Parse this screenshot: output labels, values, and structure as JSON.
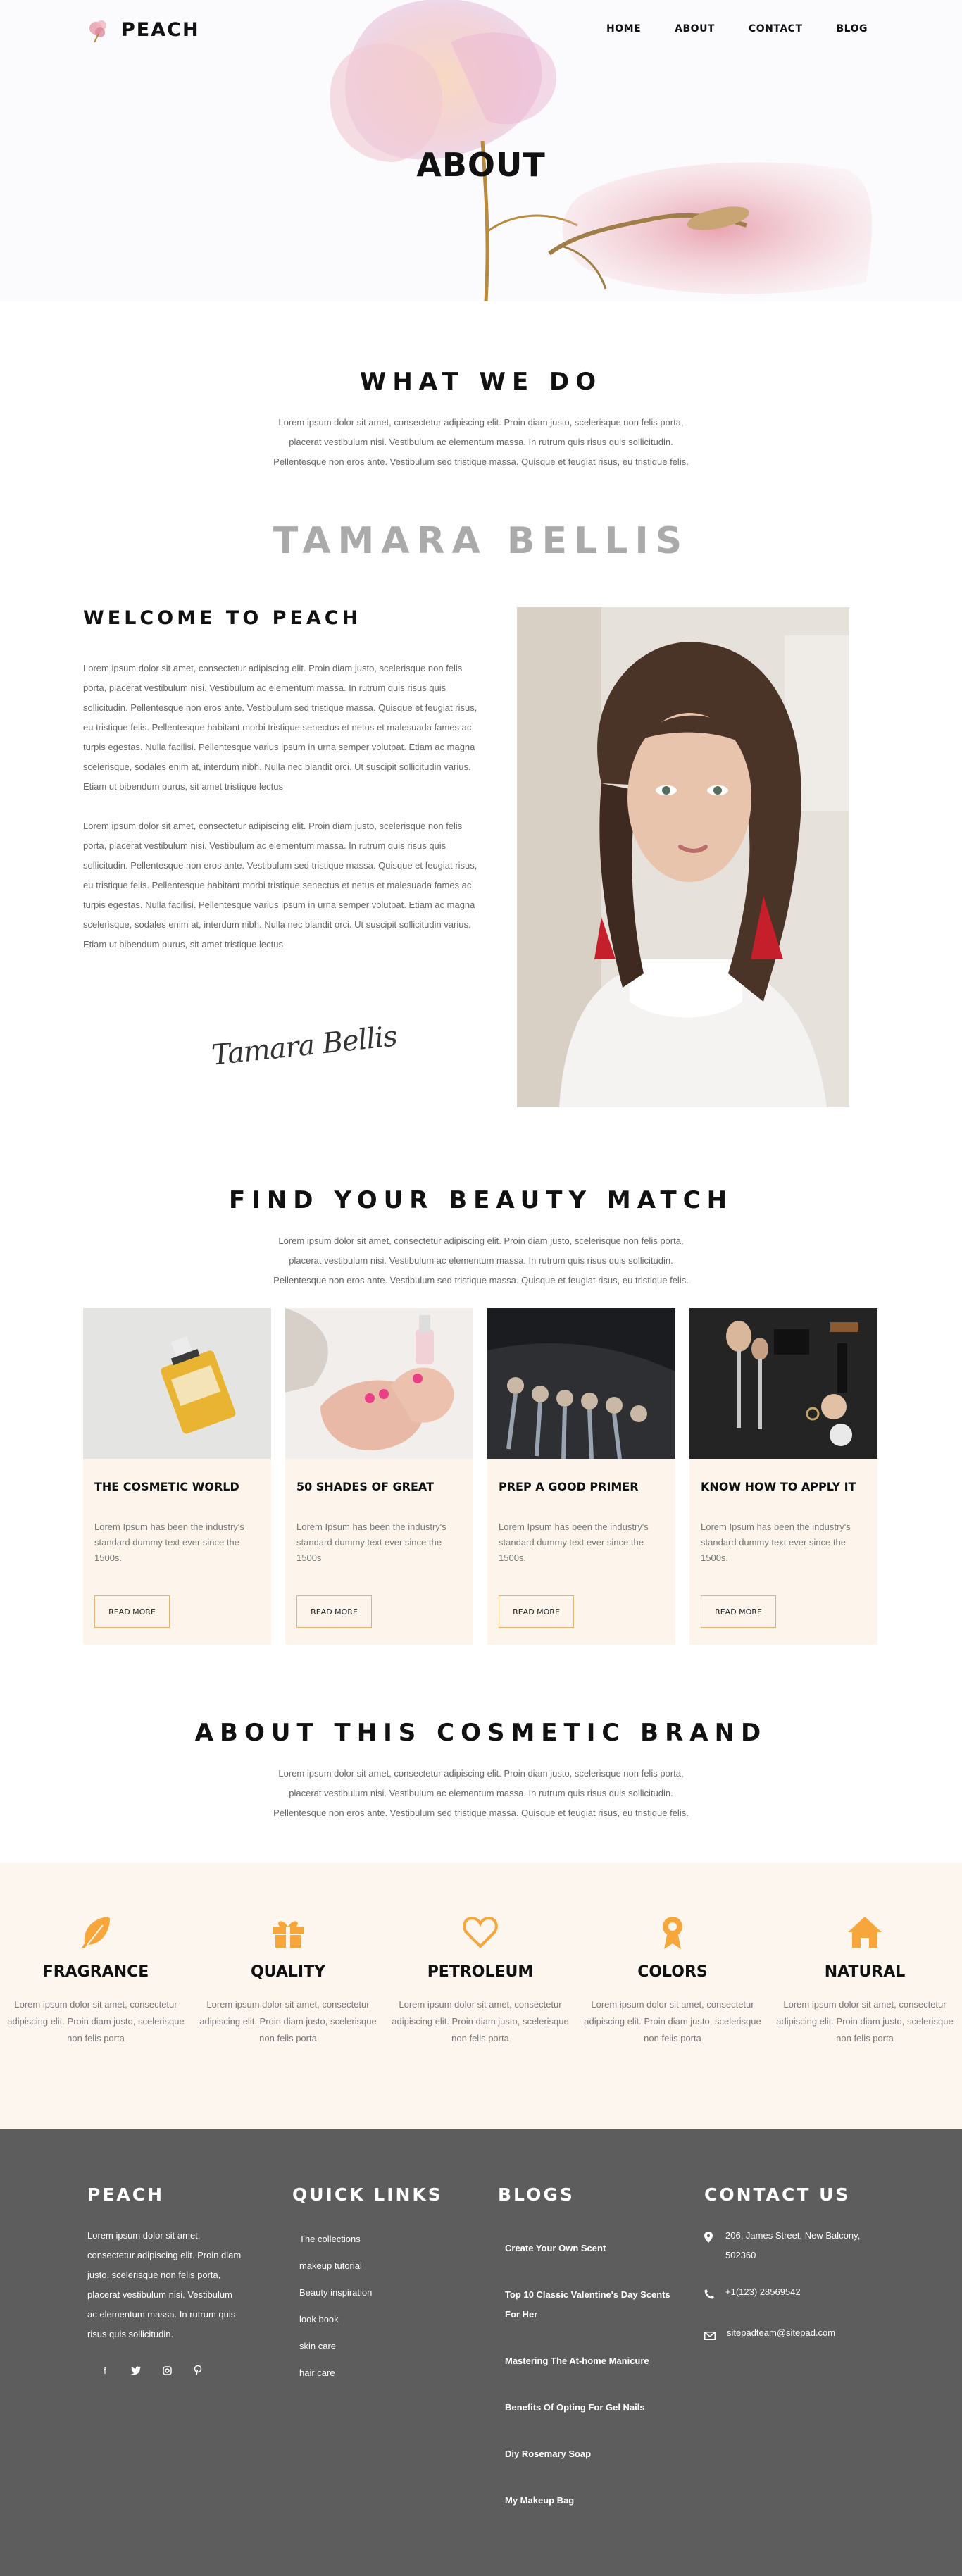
{
  "header": {
    "brand": "PEACH",
    "nav": [
      "HOME",
      "ABOUT",
      "CONTACT",
      "BLOG"
    ],
    "hero_title": "ABOUT"
  },
  "what_we_do": {
    "title": "WHAT WE DO",
    "lines": [
      "Lorem ipsum dolor sit amet, consectetur adipiscing elit. Proin diam justo, scelerisque non felis porta,",
      "placerat vestibulum nisi. Vestibulum ac elementum massa. In rutrum quis risus quis sollicitudin.",
      "Pellentesque non eros ante. Vestibulum sed tristique massa. Quisque et feugiat risus, eu tristique felis."
    ]
  },
  "founder": {
    "ghost_name": "TAMARA BELLIS",
    "heading": "WELCOME TO PEACH",
    "para1": "Lorem ipsum dolor sit amet, consectetur adipiscing elit. Proin diam justo, scelerisque non felis porta, placerat vestibulum nisi. Vestibulum ac elementum massa. In rutrum quis risus quis sollicitudin. Pellentesque non eros ante. Vestibulum sed tristique massa. Quisque et feugiat risus, eu tristique felis. Pellentesque habitant morbi tristique senectus et netus et malesuada fames ac turpis egestas. Nulla facilisi. Pellentesque varius ipsum in urna semper volutpat. Etiam ac magna scelerisque, sodales enim at, interdum nibh. Nulla nec blandit orci. Ut suscipit sollicitudin varius. Etiam ut bibendum purus, sit amet tristique lectus",
    "para2": "Lorem ipsum dolor sit amet, consectetur adipiscing elit. Proin diam justo, scelerisque non felis porta, placerat vestibulum nisi. Vestibulum ac elementum massa. In rutrum quis risus quis sollicitudin. Pellentesque non eros ante. Vestibulum sed tristique massa. Quisque et feugiat risus, eu tristique felis. Pellentesque habitant morbi tristique senectus et netus et malesuada fames ac turpis egestas. Nulla facilisi. Pellentesque varius ipsum in urna semper volutpat. Etiam ac magna scelerisque, sodales enim at, interdum nibh. Nulla nec blandit orci. Ut suscipit sollicitudin varius. Etiam ut bibendum purus, sit amet tristique lectus",
    "signature": "Tamara Bellis"
  },
  "beauty_match": {
    "title": "FIND YOUR BEAUTY MATCH",
    "lines": [
      "Lorem ipsum dolor sit amet, consectetur adipiscing elit. Proin diam justo, scelerisque non felis porta,",
      "placerat vestibulum nisi. Vestibulum ac elementum massa. In rutrum quis risus quis sollicitudin.",
      "Pellentesque non eros ante. Vestibulum sed tristique massa. Quisque et feugiat risus, eu tristique felis."
    ],
    "cards": [
      {
        "title": "THE COSMETIC WORLD",
        "text": "Lorem Ipsum has been the industry's standard dummy text ever since the 1500s.",
        "button": "READ MORE"
      },
      {
        "title": "50 SHADES OF GREAT",
        "text": "Lorem Ipsum has been the industry's standard dummy text ever since the 1500s",
        "button": "READ MORE"
      },
      {
        "title": "PREP A GOOD PRIMER",
        "text": "Lorem Ipsum has been the industry's standard dummy text ever since the 1500s.",
        "button": "READ MORE"
      },
      {
        "title": "KNOW HOW TO APPLY IT",
        "text": "Lorem Ipsum has been the industry's standard dummy text ever since the 1500s.",
        "button": "READ MORE"
      }
    ]
  },
  "brand_about": {
    "title": "ABOUT THIS COSMETIC BRAND",
    "lines": [
      "Lorem ipsum dolor sit amet, consectetur adipiscing elit. Proin diam justo, scelerisque non felis porta,",
      "placerat vestibulum nisi. Vestibulum ac elementum massa. In rutrum quis risus quis sollicitudin.",
      "Pellentesque non eros ante. Vestibulum sed tristique massa. Quisque et feugiat risus, eu tristique felis."
    ]
  },
  "features": [
    {
      "icon": "feather-icon",
      "title": "FRAGRANCE",
      "text": "Lorem ipsum dolor sit amet, consectetur adipiscing elit. Proin diam justo, scelerisque non felis porta"
    },
    {
      "icon": "gift-icon",
      "title": "QUALITY",
      "text": "Lorem ipsum dolor sit amet, consectetur adipiscing elit. Proin diam justo, scelerisque non felis porta"
    },
    {
      "icon": "heart-icon",
      "title": "PETROLEUM",
      "text": "Lorem ipsum dolor sit amet, consectetur adipiscing elit. Proin diam justo, scelerisque non felis porta"
    },
    {
      "icon": "award-icon",
      "title": "COLORS",
      "text": "Lorem ipsum dolor sit amet, consectetur adipiscing elit. Proin diam justo, scelerisque non felis porta"
    },
    {
      "icon": "home-icon",
      "title": "NATURAL",
      "text": "Lorem ipsum dolor sit amet, consectetur adipiscing elit. Proin diam justo, scelerisque non felis porta"
    }
  ],
  "footer": {
    "about_title": "PEACH",
    "about_text": "Lorem ipsum dolor sit amet, consectetur adipiscing elit. Proin diam justo, scelerisque non felis porta, placerat vestibulum nisi. Vestibulum ac elementum massa. In rutrum quis risus quis sollicitudin.",
    "socials": [
      "facebook-icon",
      "twitter-icon",
      "instagram-icon",
      "pinterest-icon"
    ],
    "links_title": "QUICK LINKS",
    "links": [
      "The collections",
      "makeup tutorial",
      "Beauty inspiration",
      "look book",
      "skin care",
      "hair care"
    ],
    "blogs_title": "BLOGS",
    "blogs": [
      "Create Your Own Scent",
      "Top 10 Classic Valentine's Day Scents For Her",
      "Mastering The At-home Manicure",
      "Benefits Of Opting For Gel Nails",
      "Diy Rosemary Soap",
      "My Makeup Bag"
    ],
    "contact_title": "CONTACT US",
    "address": "206, James Street, New Balcony, 502360",
    "phone": "+1(123) 28569542",
    "email": "sitepadteam@sitepad.com"
  },
  "colors": {
    "accent": "#f6a63b",
    "footer_bg": "#5d5d5d",
    "card_bg": "#fdf5ec",
    "button_border": "#e2b273"
  }
}
